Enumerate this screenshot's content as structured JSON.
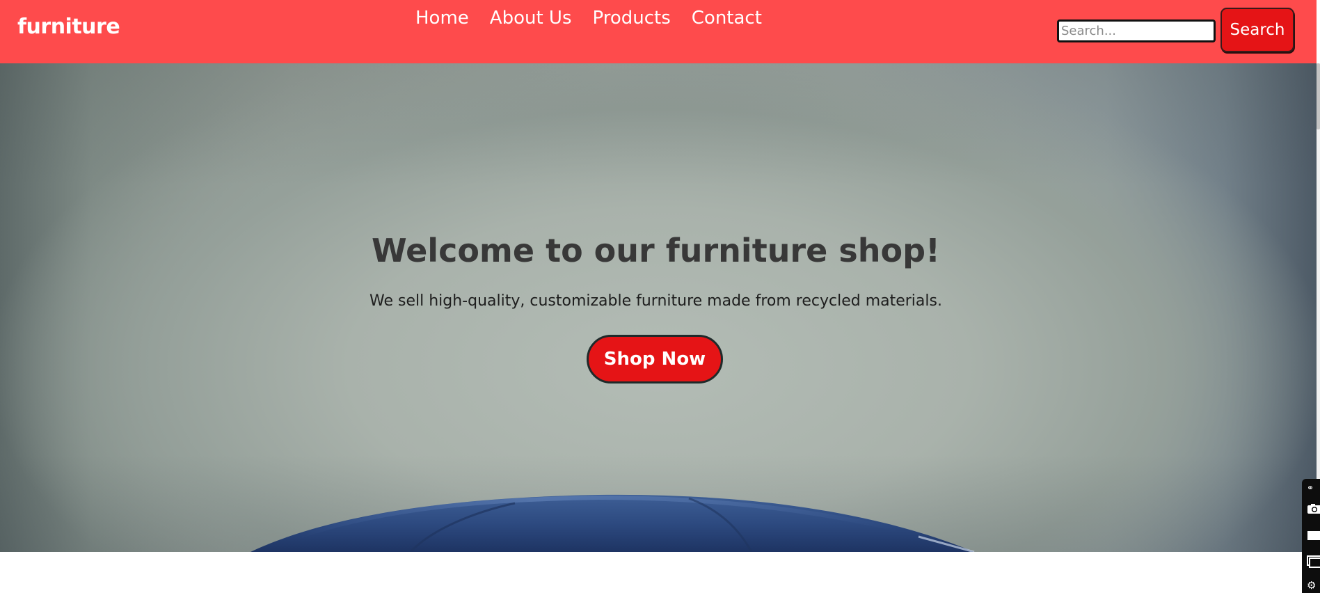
{
  "header": {
    "logo": "furniture",
    "nav": [
      "Home",
      "About Us",
      "Products",
      "Contact"
    ],
    "search": {
      "placeholder": "Search...",
      "button_label": "Search"
    }
  },
  "hero": {
    "title": "Welcome to our furniture shop!",
    "subtitle": "We sell high-quality, customizable furniture made from recycled materials.",
    "cta_label": "Shop Now"
  },
  "colors": {
    "header_bg": "#fe4b4c",
    "button_red": "#e51416",
    "hero_title": "#383838",
    "sofa_blue": "#2d4a80"
  },
  "floating_toolbar": {
    "icons": [
      "link-icon",
      "camera-icon",
      "rectangle-icon",
      "window-icon",
      "settings-icon"
    ]
  }
}
